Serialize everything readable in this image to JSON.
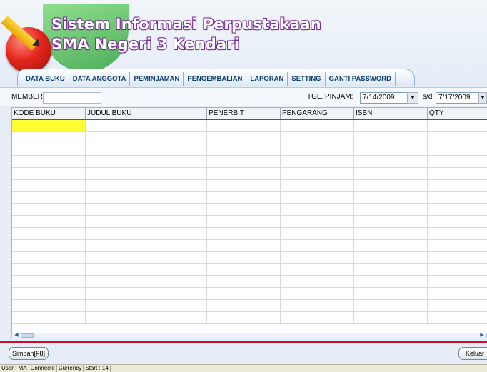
{
  "app": {
    "title_line1": "Sistem Informasi Perpustakaan",
    "title_line2": "SMA Negeri 3 Kendari"
  },
  "tabs": [
    "DATA BUKU",
    "DATA ANGGOTA",
    "PEMINJAMAN",
    "PENGEMBALIAN",
    "LAPORAN",
    "SETTING",
    "GANTI PASSWORD"
  ],
  "filter": {
    "member_label": "MEMBER",
    "member_value": "",
    "tgl_label": "TGL. PINJAM:",
    "date_from": "7/14/2009",
    "separator": "s/d",
    "date_to": "7/17/2009"
  },
  "grid": {
    "columns": [
      "KODE BUKU",
      "JUDUL BUKU",
      "PENERBIT",
      "PENGARANG",
      "ISBN",
      "QTY"
    ],
    "empty_rows": 17
  },
  "buttons": {
    "save": "Simpan[F8]",
    "exit": "Keluar"
  },
  "status": {
    "user": "User : MA",
    "connection": "Connecte",
    "currency": "Currency",
    "start": "Start : 14"
  },
  "colors": {
    "accent_red": "#c8102e",
    "active_cell": "#ffff33",
    "tab_text": "#0b3a6e"
  }
}
